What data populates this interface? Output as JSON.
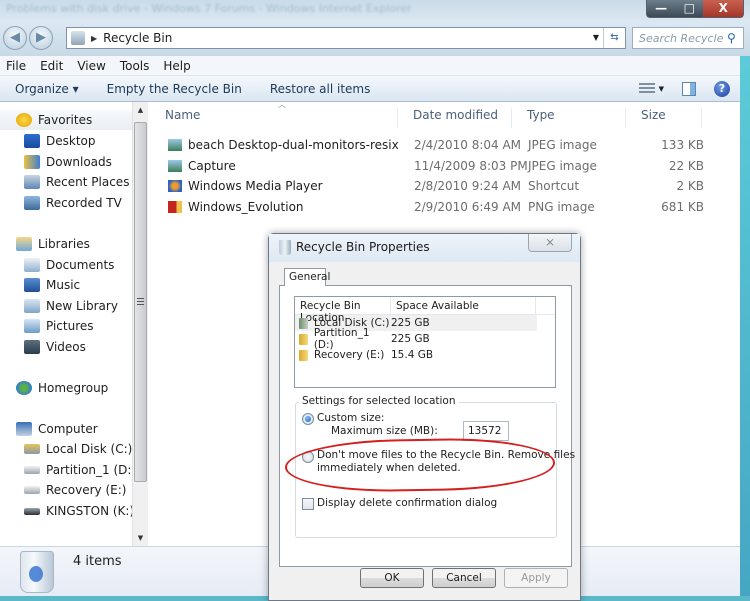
{
  "window": {
    "background_title": "Problems with disk drive - Windows 7 Forums - Windows Internet Explorer",
    "controls": {
      "minimize": "—",
      "maximize": "□",
      "close": "X"
    }
  },
  "nav": {
    "back": "◀",
    "forward": "▶"
  },
  "address": {
    "icon": "recycle-bin-icon",
    "crumb": "Recycle Bin"
  },
  "search": {
    "placeholder": "Search Recycle ...",
    "icon": "⚲"
  },
  "menu": [
    "File",
    "Edit",
    "View",
    "Tools",
    "Help"
  ],
  "toolbar": {
    "organize": "Organize ▾",
    "empty": "Empty the Recycle Bin",
    "restore": "Restore all items",
    "help_icon": "?"
  },
  "sidebar": {
    "favorites": {
      "label": "Favorites",
      "items": [
        "Desktop",
        "Downloads",
        "Recent Places",
        "Recorded TV"
      ]
    },
    "libraries": {
      "label": "Libraries",
      "items": [
        "Documents",
        "Music",
        "New Library",
        "Pictures",
        "Videos"
      ]
    },
    "homegroup": {
      "label": "Homegroup"
    },
    "computer": {
      "label": "Computer",
      "items": [
        "Local Disk (C:)",
        "Partition_1 (D:)",
        "Recovery (E:)",
        "KINGSTON (K:)"
      ]
    }
  },
  "columns": {
    "name": "Name",
    "date": "Date modified",
    "type": "Type",
    "size": "Size"
  },
  "files": [
    {
      "name": "beach Desktop-dual-monitors-resix",
      "date": "2/4/2010 8:04 AM",
      "type": "JPEG image",
      "size": "133 KB",
      "icon": "jpeg-icon"
    },
    {
      "name": "Capture",
      "date": "11/4/2009 8:03 PM",
      "type": "JPEG image",
      "size": "22 KB",
      "icon": "jpeg-icon"
    },
    {
      "name": "Windows Media Player",
      "date": "2/8/2010 9:24 AM",
      "type": "Shortcut",
      "size": "2 KB",
      "icon": "media-player-icon"
    },
    {
      "name": "Windows_Evolution",
      "date": "2/9/2010 6:49 AM",
      "type": "PNG image",
      "size": "681 KB",
      "icon": "png-icon"
    }
  ],
  "status": {
    "count": "4 items"
  },
  "dialog": {
    "title": "Recycle Bin Properties",
    "close": "⨯",
    "tab": "General",
    "list_headers": {
      "location": "Recycle Bin Location",
      "space": "Space Available"
    },
    "locations": [
      {
        "name": "Local Disk (C:)",
        "space": "225 GB",
        "selected": true
      },
      {
        "name": "Partition_1 (D:)",
        "space": "225 GB",
        "selected": false
      },
      {
        "name": "Recovery (E:)",
        "space": "15.4 GB",
        "selected": false
      }
    ],
    "settings_legend": "Settings for selected location",
    "custom_size_label": "Custom size:",
    "custom_size_selected": true,
    "max_size_label": "Maximum size (MB):",
    "max_size_value": "13572",
    "dont_move_line1": "Don't move files to the Recycle Bin. Remove files",
    "dont_move_line2": "immediately when deleted.",
    "dont_move_selected": false,
    "confirm_label": "Display delete confirmation dialog",
    "confirm_checked": false,
    "buttons": {
      "ok": "OK",
      "cancel": "Cancel",
      "apply": "Apply"
    },
    "annotation_color": "#d42020"
  }
}
